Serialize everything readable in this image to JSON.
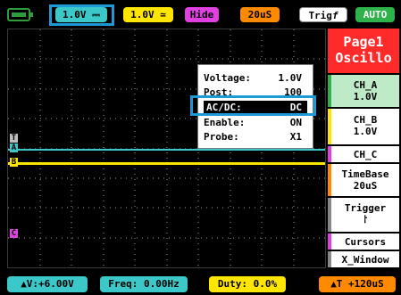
{
  "colors": {
    "channel_a": "#3cc8c8",
    "channel_b": "#ffe600",
    "channel_c": "#e040e0",
    "page_header": "#ff2a2a",
    "highlight": "#1c9ad6",
    "trigger_pill": "#ff8a00"
  },
  "top_bar": {
    "battery_icon": "battery-icon",
    "ch_a_scale": "1.0V ⎓",
    "ch_b_scale": "1.0V ≃",
    "hide_label": "Hide",
    "timebase": "20uS",
    "trigger_label": "Trig",
    "trigger_edge_icon": "rising-edge-icon",
    "trigger_edge": "f",
    "mode": "AUTO"
  },
  "sidebar": {
    "page_title": "Page1",
    "page_subtitle": "Oscillo",
    "items": [
      {
        "label": "CH_A",
        "value": "1.0V"
      },
      {
        "label": "CH_B",
        "value": "1.0V"
      },
      {
        "label": "CH_C",
        "value": ""
      },
      {
        "label": "TimeBase",
        "value": "20uS"
      },
      {
        "label": "Trigger",
        "value": "⸷"
      },
      {
        "label": "Cursors",
        "value": ""
      },
      {
        "label": "X_Window",
        "value": ""
      }
    ]
  },
  "popup": {
    "rows": [
      {
        "key": "Voltage:",
        "value": "1.0V"
      },
      {
        "key": "Post:",
        "value": "100"
      },
      {
        "key": "AC/DC:",
        "value": "DC"
      },
      {
        "key": "Enable:",
        "value": "ON"
      },
      {
        "key": "Probe:",
        "value": "X1"
      }
    ]
  },
  "markers": {
    "trigger": "T",
    "a": "A",
    "b": "B",
    "c": "C"
  },
  "bottom_bar": {
    "voltage": "▲V:+6.00V",
    "freq": "Freq: 0.00Hz",
    "duty": "Duty: 0.0%",
    "time": "▲T +120uS"
  }
}
